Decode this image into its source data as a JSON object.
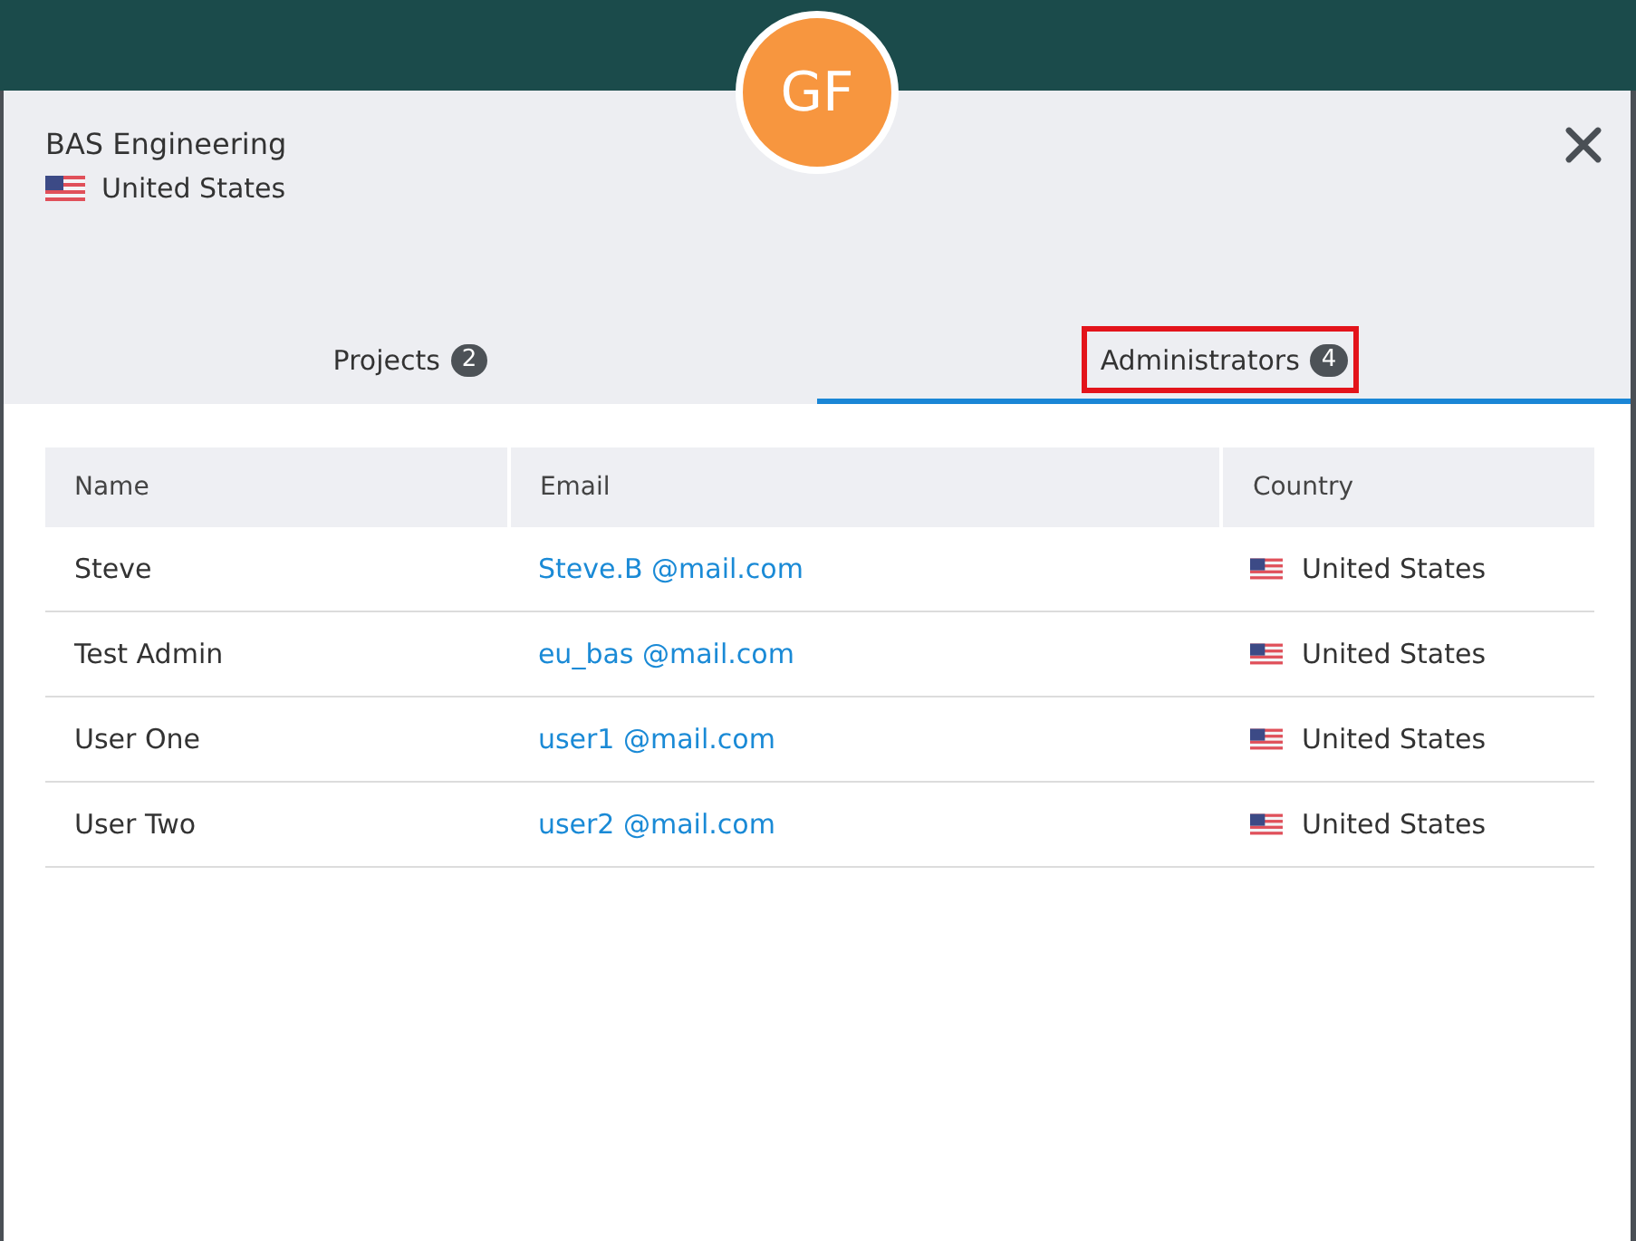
{
  "dialog": {
    "avatar_initials": "GF",
    "title": "BAS Engineering",
    "country": "United States"
  },
  "tabs": [
    {
      "label": "Projects",
      "count": "2",
      "selected": false,
      "highlighted": false
    },
    {
      "label": "Administrators",
      "count": "4",
      "selected": true,
      "highlighted": true
    }
  ],
  "table": {
    "columns": [
      "Name",
      "Email",
      "Country"
    ],
    "rows": [
      {
        "name": "Steve",
        "email": "Steve.B @mail.com",
        "country": "United States"
      },
      {
        "name": "Test Admin",
        "email": "eu_bas @mail.com",
        "country": "United States"
      },
      {
        "name": "User One",
        "email": "user1 @mail.com",
        "country": "United States"
      },
      {
        "name": "User Two",
        "email": "user2 @mail.com",
        "country": "United States"
      }
    ]
  }
}
